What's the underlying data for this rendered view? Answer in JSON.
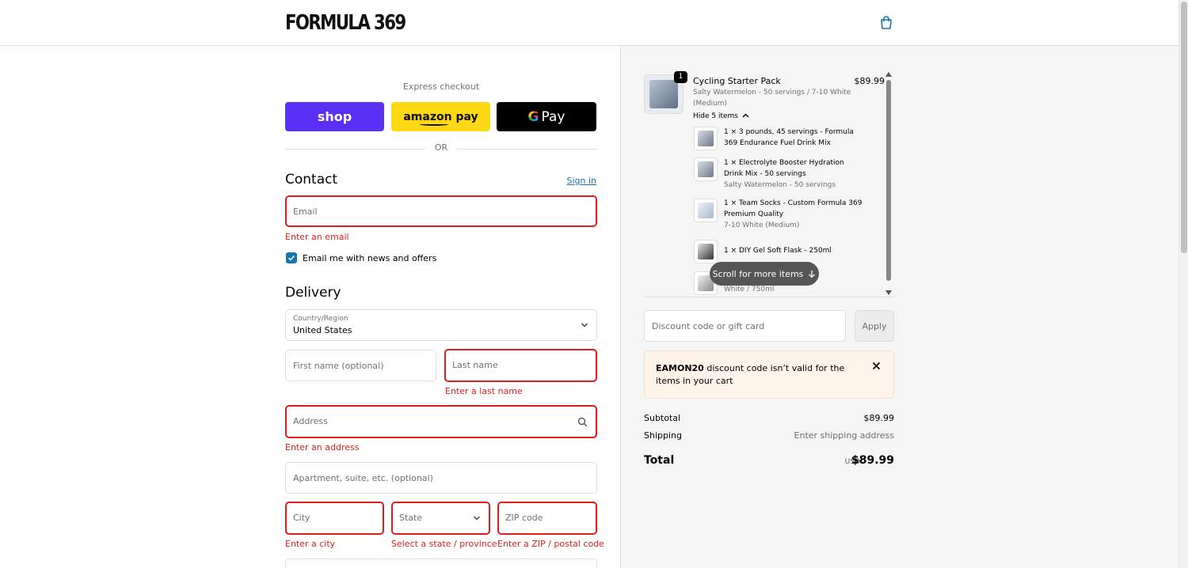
{
  "header": {
    "logo": "FORMULA 369",
    "cart_icon": "shopping-bag-icon"
  },
  "express": {
    "label": "Express checkout",
    "shop_label": "shop",
    "amazon_label": "amazon pay",
    "gpay_g": "G",
    "gpay_label": "Pay",
    "or_label": "OR"
  },
  "contact": {
    "heading": "Contact",
    "sign_in": "Sign in",
    "email_placeholder": "Email",
    "email_error": "Enter an email",
    "newsletter_label": "Email me with news and offers",
    "newsletter_checked": true
  },
  "delivery": {
    "heading": "Delivery",
    "country_label": "Country/Region",
    "country_value": "United States",
    "first_name_placeholder": "First name (optional)",
    "last_name_placeholder": "Last name",
    "last_name_error": "Enter a last name",
    "address_placeholder": "Address",
    "address_error": "Enter an address",
    "apartment_placeholder": "Apartment, suite, etc. (optional)",
    "city_placeholder": "City",
    "city_error": "Enter a city",
    "state_placeholder": "State",
    "state_error": "Select a state / province",
    "zip_placeholder": "ZIP code",
    "zip_error": "Enter a ZIP / postal code"
  },
  "order": {
    "quantity": "1",
    "product_title": "Cycling Starter Pack",
    "product_variant_line1": "Salty Watermelon - 50 servings / 7-10 White",
    "product_variant_line2": "(Medium)",
    "product_price": "$89.99",
    "hide_items_label": "Hide 5 items",
    "items": [
      {
        "line1": "1 × 3 pounds, 45 servings - Formula",
        "line2": "369 Endurance Fuel Drink Mix",
        "variant": ""
      },
      {
        "line1": "1 × Electrolyte Booster Hydration",
        "line2": "Drink Mix - 50 servings",
        "variant": "Salty Watermelon - 50 servings"
      },
      {
        "line1": "1 × Team Socks - Custom Formula 369",
        "line2": "Premium Quality",
        "variant": "7-10 White (Medium)"
      },
      {
        "line1": "1 × DIY Gel Soft Flask - 250ml",
        "line2": "",
        "variant": ""
      },
      {
        "line1": "",
        "line2": "",
        "variant": "White / 750ml"
      }
    ],
    "scroll_hint": "Scroll for more items"
  },
  "discount": {
    "placeholder": "Discount code or gift card",
    "apply_label": "Apply",
    "alert_code": "EAMON20",
    "alert_text": " discount code isn’t valid for the items in your cart"
  },
  "summary": {
    "subtotal_label": "Subtotal",
    "subtotal_value": "$89.99",
    "shipping_label": "Shipping",
    "shipping_value": "Enter shipping address",
    "total_label": "Total",
    "currency": "USD",
    "total_value": "$89.99"
  },
  "colors": {
    "shop": "#5a31f4",
    "amazon": "#ffd814",
    "gpay": "#000000",
    "error": "#dd1d1d",
    "link": "#1773b0"
  }
}
